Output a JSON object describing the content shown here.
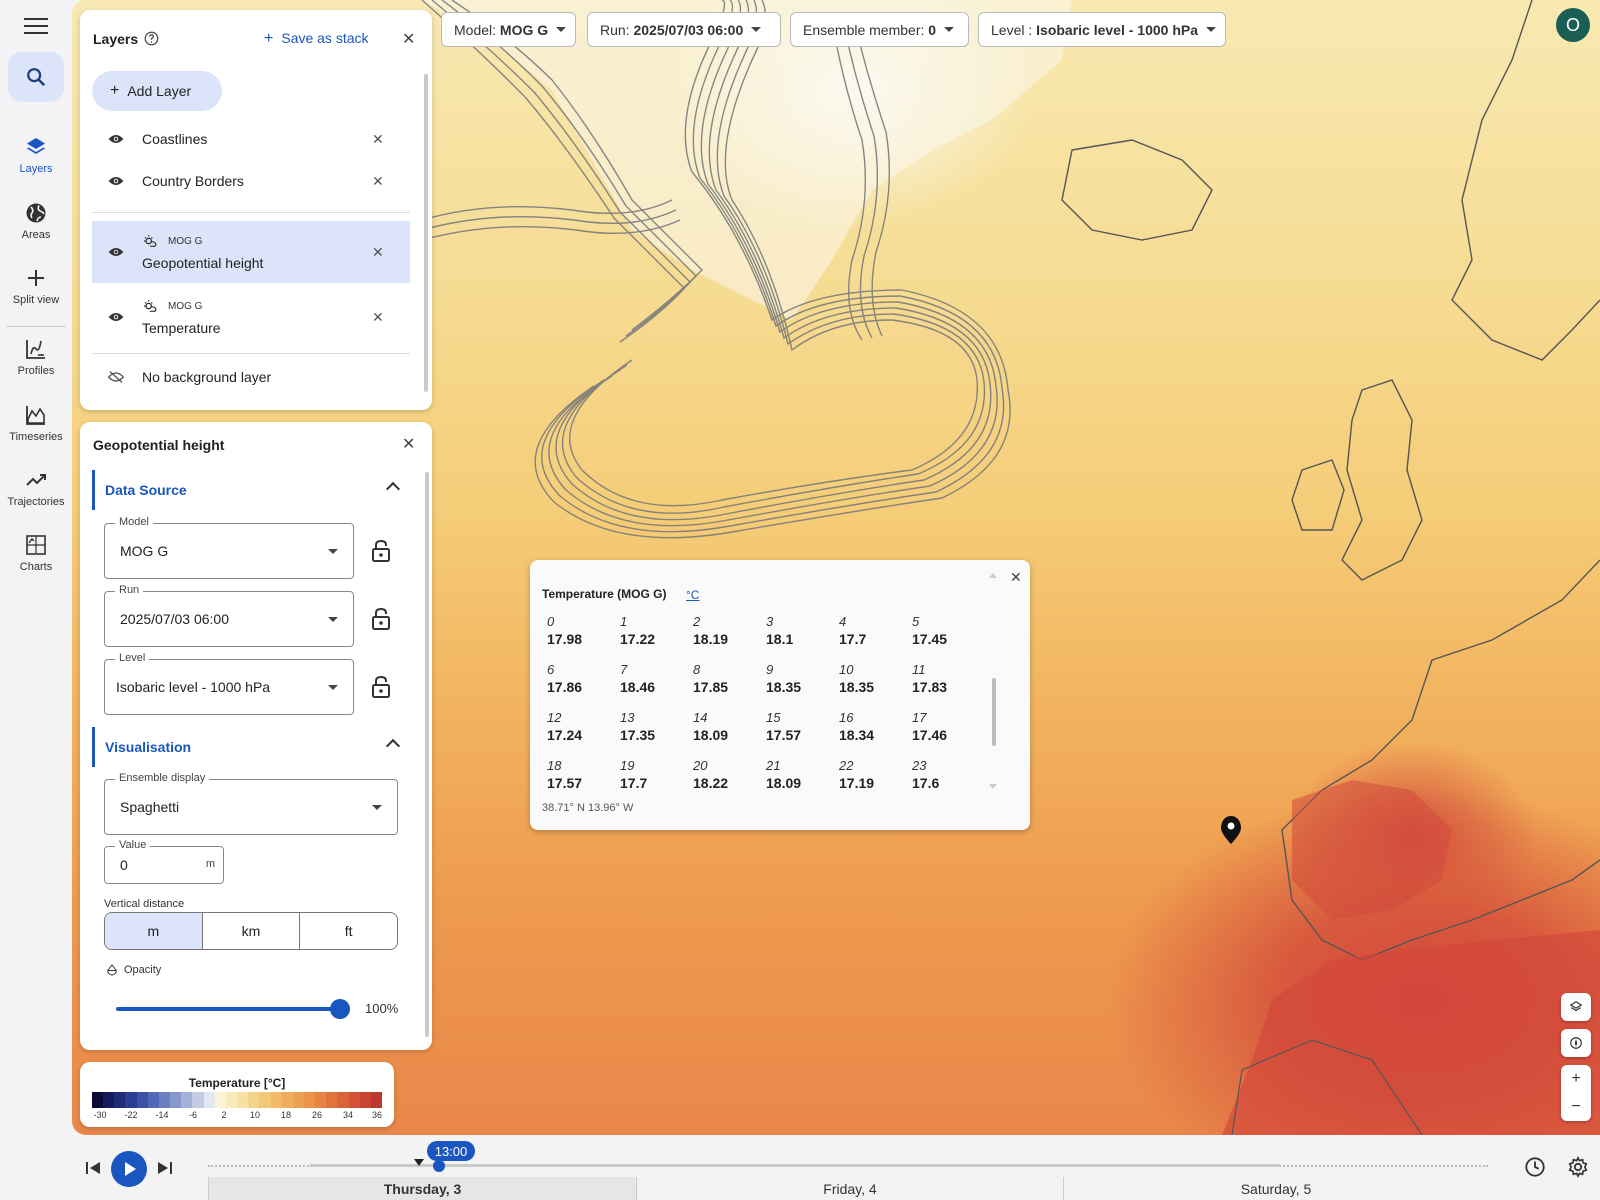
{
  "rail": {
    "items": [
      {
        "label": "Layers"
      },
      {
        "label": "Areas"
      },
      {
        "label": "Split view"
      },
      {
        "label": "Profiles"
      },
      {
        "label": "Timeseries"
      },
      {
        "label": "Trajectories"
      },
      {
        "label": "Charts"
      }
    ]
  },
  "top_chips": {
    "model_prefix": "Model:",
    "model": "MOG G",
    "run_prefix": "Run:",
    "run": "2025/07/03 06:00",
    "member_prefix": "Ensemble member:",
    "member": "0",
    "level_prefix": "Level :",
    "level": "Isobaric level - 1000 hPa"
  },
  "avatar": {
    "initial": "O",
    "color": "#1b5e55"
  },
  "layers_panel": {
    "title": "Layers",
    "save_stack": "Save as stack",
    "add_layer": "Add Layer",
    "layers": [
      {
        "name": "Coastlines"
      },
      {
        "name": "Country Borders"
      },
      {
        "tag": "MOG G",
        "name": "Geopotential height"
      },
      {
        "tag": "MOG G",
        "name": "Temperature"
      }
    ],
    "background": "No background layer"
  },
  "geo_panel": {
    "title": "Geopotential height",
    "data_source": "Data Source",
    "model_label": "Model",
    "model_value": "MOG G",
    "run_label": "Run",
    "run_value": "2025/07/03 06:00",
    "level_label": "Level",
    "level_value": "Isobaric level - 1000 hPa",
    "visualisation": "Visualisation",
    "ensemble_label": "Ensemble display",
    "ensemble_value": "Spaghetti",
    "value_label": "Value",
    "value_value": "0",
    "value_unit": "m",
    "vertical_label": "Vertical distance",
    "units": [
      "m",
      "km",
      "ft"
    ],
    "opacity_label": "Opacity",
    "opacity_value": "100%"
  },
  "legend": {
    "title": "Temperature [°C]",
    "ticks": [
      "-30",
      "-22",
      "-14",
      "-6",
      "2",
      "10",
      "18",
      "26",
      "34",
      "36"
    ],
    "colors": [
      "#0c0c3a",
      "#141a5a",
      "#1f2a78",
      "#2b3c92",
      "#3b52a8",
      "#5068b6",
      "#6a80c2",
      "#8698cc",
      "#a4b1d8",
      "#c3cce4",
      "#e2e7f2",
      "#fbf4d8",
      "#f8ebbd",
      "#f6e0a2",
      "#f4d48a",
      "#f3c877",
      "#f1bb69",
      "#efad5d",
      "#eda052",
      "#ea9349",
      "#e78443",
      "#e2743e",
      "#dc633a",
      "#d55237",
      "#cb4334",
      "#be3630"
    ]
  },
  "popup": {
    "title": "Temperature  (MOG G)",
    "unit": "°C",
    "cells": [
      {
        "i": "0",
        "v": "17.98"
      },
      {
        "i": "1",
        "v": "17.22"
      },
      {
        "i": "2",
        "v": "18.19"
      },
      {
        "i": "3",
        "v": "18.1"
      },
      {
        "i": "4",
        "v": "17.7"
      },
      {
        "i": "5",
        "v": "17.45"
      },
      {
        "i": "6",
        "v": "17.86"
      },
      {
        "i": "7",
        "v": "18.46"
      },
      {
        "i": "8",
        "v": "17.85"
      },
      {
        "i": "9",
        "v": "18.35"
      },
      {
        "i": "10",
        "v": "18.35"
      },
      {
        "i": "11",
        "v": "17.83"
      },
      {
        "i": "12",
        "v": "17.24"
      },
      {
        "i": "13",
        "v": "17.35"
      },
      {
        "i": "14",
        "v": "18.09"
      },
      {
        "i": "15",
        "v": "17.57"
      },
      {
        "i": "16",
        "v": "18.34"
      },
      {
        "i": "17",
        "v": "17.46"
      },
      {
        "i": "18",
        "v": "17.57"
      },
      {
        "i": "19",
        "v": "17.7"
      },
      {
        "i": "20",
        "v": "18.22"
      },
      {
        "i": "21",
        "v": "18.09"
      },
      {
        "i": "22",
        "v": "17.19"
      },
      {
        "i": "23",
        "v": "17.6"
      }
    ],
    "coords": "38.71° N 13.96° W"
  },
  "timeline": {
    "time": "13:00",
    "days": [
      "Thursday, 3",
      "Friday, 4",
      "Saturday, 5"
    ]
  }
}
